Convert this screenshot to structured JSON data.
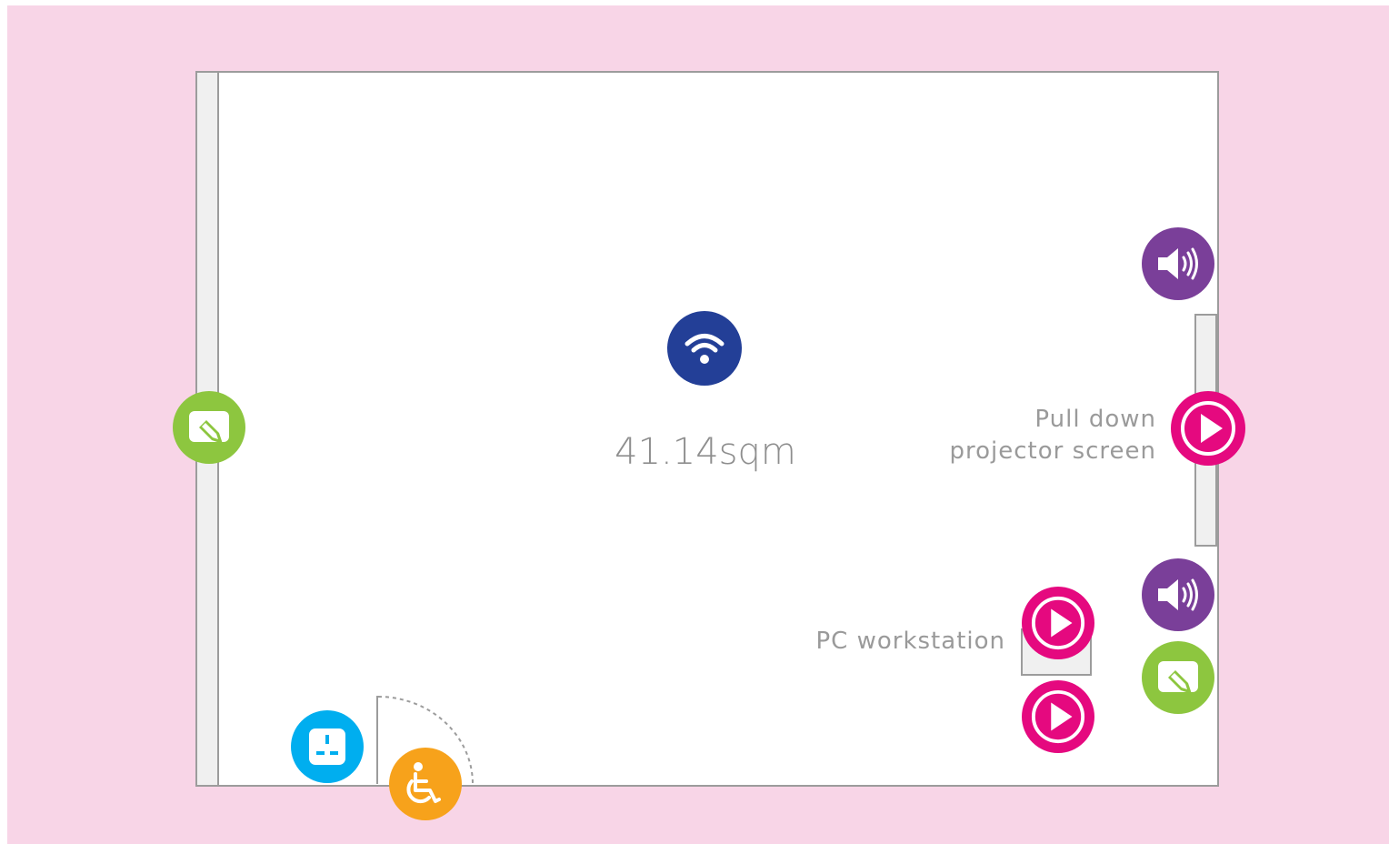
{
  "room": {
    "area": "41.14sqm"
  },
  "labels": {
    "projector_line1": "Pull down",
    "projector_line2": "projector screen",
    "pc": "PC workstation"
  },
  "colors": {
    "background": "#f8d5e7",
    "wifi": "#233f97",
    "speaker": "#7a3f99",
    "play": "#e5097f",
    "whiteboard": "#8dc63f",
    "power": "#00aeef",
    "accessible": "#f7a21b"
  },
  "icons": {
    "wifi": "wifi-icon",
    "speaker": "speaker-icon",
    "play": "play-icon",
    "whiteboard": "whiteboard-icon",
    "power": "power-socket-icon",
    "accessible": "wheelchair-icon"
  }
}
